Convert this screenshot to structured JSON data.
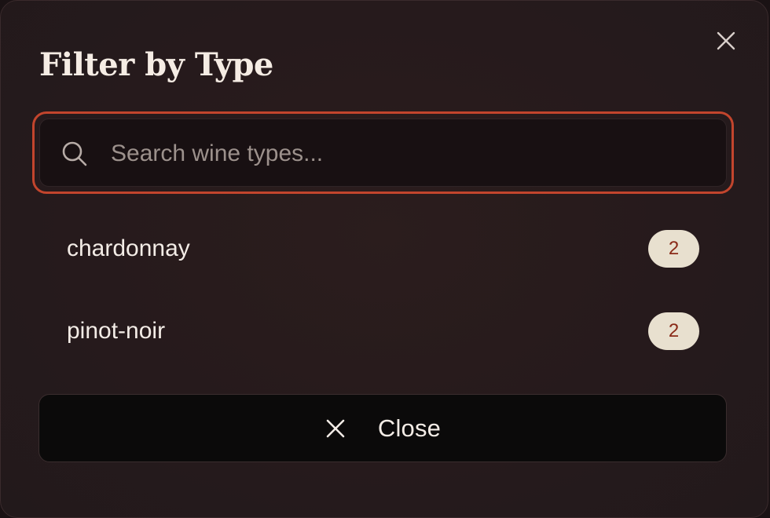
{
  "dialog": {
    "title": "Filter by Type",
    "close_icon": "close-icon"
  },
  "search": {
    "placeholder": "Search wine types...",
    "value": "",
    "icon": "search-icon",
    "focus_color": "#c2452d"
  },
  "types": [
    {
      "label": "chardonnay",
      "count": "2"
    },
    {
      "label": "pinot-noir",
      "count": "2"
    }
  ],
  "footer": {
    "close_label": "Close",
    "close_icon": "close-icon"
  },
  "colors": {
    "background": "#261a1c",
    "badge_bg": "#e8e0cf",
    "badge_text": "#8a2a18",
    "button_bg": "#0b0a0a"
  }
}
